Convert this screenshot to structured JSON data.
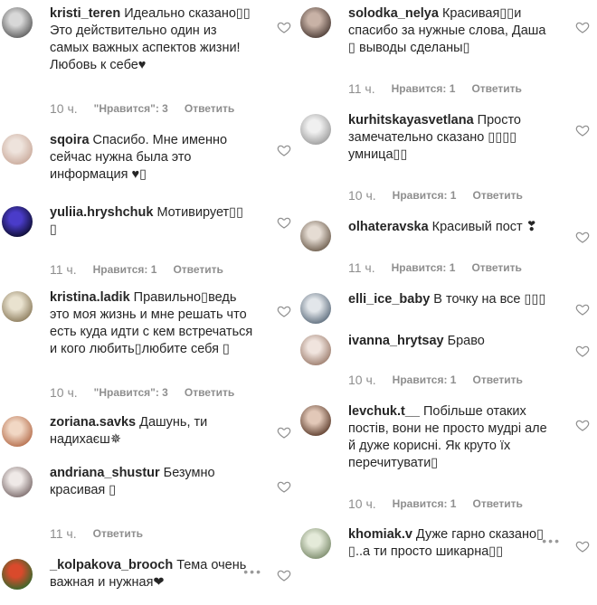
{
  "left": [
    {
      "user": "kristi_teren",
      "text": "Идеально сказано▯▯\nЭто действительно один из\nсамых важных аспектов жизни!\nЛюбовь к себе♥",
      "time": "10 ч.",
      "likes": "\"Нравится\": 3",
      "reply": "Ответить",
      "avatar": [
        "#5a5a5a",
        "#d8d8d8"
      ]
    },
    {
      "user": "sqoira",
      "text": "Спасибо. Мне именно\nсейчас нужна была это\nинформация ♥▯",
      "time": "",
      "likes": "",
      "reply": "",
      "avatar": [
        "#c9a99a",
        "#eee3dc"
      ]
    },
    {
      "user": "yuliia.hryshchuk",
      "text": "Мотивирует▯▯\n▯",
      "time": "11 ч.",
      "likes": "Нравится: 1",
      "reply": "Ответить",
      "avatar": [
        "#0b0b2a",
        "#4a3cc9"
      ]
    },
    {
      "user": "kristina.ladik",
      "text": "Правильно▯ведь\nэто моя жизнь и мне решать что\nесть куда идти с кем встречаться\nи кого любить▯любите себя ▯",
      "time": "10 ч.",
      "likes": "\"Нравится\": 3",
      "reply": "Ответить",
      "avatar": [
        "#8a7a5a",
        "#e9e2cf"
      ]
    },
    {
      "user": "zoriana.savks",
      "text": "Дашунь, ти\nнадихаєш✵",
      "time": "",
      "likes": "",
      "reply": "",
      "avatar": [
        "#b46c4a",
        "#f1d7c4"
      ]
    },
    {
      "user": "andriana_shustur",
      "text": "Безумно\nкрасивая ▯",
      "time": "11 ч.",
      "likes": "",
      "reply": "Ответить",
      "avatar": [
        "#7a6a6a",
        "#efe9e7"
      ]
    },
    {
      "user": "_kolpakova_brooch",
      "text": "Тема очень\nважная и нужная❤",
      "time": "",
      "likes": "",
      "reply": "",
      "avatar": [
        "#2c6a2c",
        "#d94a2c"
      ]
    }
  ],
  "right": [
    {
      "user": "solodka_nelya",
      "text": "Красивая▯▯и\nспасибо за нужные слова, Даша\n▯ выводы сделаны▯",
      "time": "11 ч.",
      "likes": "Нравится: 1",
      "reply": "Ответить",
      "avatar": [
        "#4a3a34",
        "#c8b2a6"
      ]
    },
    {
      "user": "kurhitskayasvetlana",
      "text": "Просто\nзамечательно сказано ▯▯▯▯\nумница▯▯",
      "time": "10 ч.",
      "likes": "Нравится: 1",
      "reply": "Ответить",
      "avatar": [
        "#9a9a9a",
        "#f0f0f0"
      ]
    },
    {
      "user": "olhateravska",
      "text": "Красивый пост ❣",
      "time": "11 ч.",
      "likes": "Нравится: 1",
      "reply": "Ответить",
      "avatar": [
        "#6a5a4a",
        "#e5dcd3"
      ]
    },
    {
      "user": "elli_ice_baby",
      "text": "В точку на все ▯▯▯",
      "time": "",
      "likes": "",
      "reply": "",
      "avatar": [
        "#5a6a7a",
        "#e2e6ea"
      ]
    },
    {
      "user": "ivanna_hrytsay",
      "text": "Браво",
      "time": "10 ч.",
      "likes": "Нравится: 1",
      "reply": "Ответить",
      "avatar": [
        "#9a7a6a",
        "#f0e4de"
      ]
    },
    {
      "user": "levchuk.t__",
      "text": "Побільше отаких\nпостів, вони не просто мудрі але\nй дуже корисні. Як круто їх\nперечитувати▯",
      "time": "10 ч.",
      "likes": "Нравится: 1",
      "reply": "Ответить",
      "avatar": [
        "#5a3a2a",
        "#e2c8b8"
      ]
    },
    {
      "user": "khomiak.v",
      "text": "Дуже гарно сказано▯\n▯..а ти просто шикарна▯▯",
      "time": "",
      "likes": "",
      "reply": "",
      "avatar": [
        "#7a8a6a",
        "#e4ead9"
      ]
    }
  ],
  "icons": {
    "heart": "heart-outline-icon",
    "more": "more-dots-icon"
  }
}
